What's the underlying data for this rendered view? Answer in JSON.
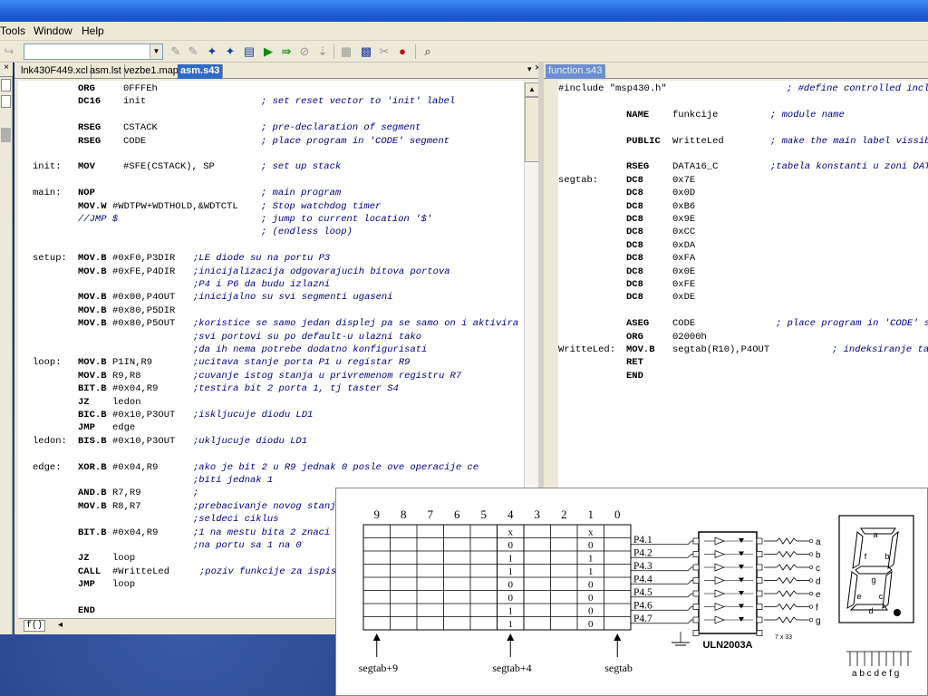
{
  "menu": {
    "items": [
      "Tools",
      "Window",
      "Help"
    ]
  },
  "toolbar": {
    "combo_value": ""
  },
  "left_editor": {
    "tabs": [
      "lnk430F449.xcl",
      "asm.lst",
      "vezbe1.map",
      "asm.s43"
    ],
    "active_tab": "asm.s43",
    "lines": [
      {
        "label": "",
        "op": "ORG",
        "arg": "0FFFEh",
        "comment": ""
      },
      {
        "label": "",
        "op": "DC16",
        "arg": "init",
        "comment": "; set reset vector to 'init' label"
      },
      {
        "label": "",
        "op": "",
        "arg": "",
        "comment": ""
      },
      {
        "label": "",
        "op": "RSEG",
        "arg": "CSTACK",
        "comment": "; pre-declaration of segment"
      },
      {
        "label": "",
        "op": "RSEG",
        "arg": "CODE",
        "comment": "; place program in 'CODE' segment"
      },
      {
        "label": "",
        "op": "",
        "arg": "",
        "comment": ""
      },
      {
        "label": "init:",
        "op": "MOV",
        "arg": "#SFE(CSTACK), SP",
        "comment": "; set up stack"
      },
      {
        "label": "",
        "op": "",
        "arg": "",
        "comment": ""
      },
      {
        "label": "main:",
        "op": "NOP",
        "arg": "",
        "comment": "; main program"
      },
      {
        "label": "",
        "op": "MOV.W",
        "arg": "#WDTPW+WDTHOLD,&WDTCTL",
        "comment": "; Stop watchdog timer"
      },
      {
        "label": "",
        "op": "",
        "arg": "",
        "comment": "//JMP $",
        "comment2": "; jump to current location '$'"
      },
      {
        "label": "",
        "op": "",
        "arg": "",
        "comment": "; (endless loop)"
      },
      {
        "label": "",
        "op": "",
        "arg": "",
        "comment": ""
      },
      {
        "label": "setup:",
        "op": "MOV.B",
        "arg": "#0xF0,P3DIR",
        "comment": ";LE diode su na portu P3"
      },
      {
        "label": "",
        "op": "MOV.B",
        "arg": "#0xFE,P4DIR",
        "comment": ";inicijalizacija odgovarajucih bitova portova"
      },
      {
        "label": "",
        "op": "",
        "arg": "",
        "comment": ";P4 i P6 da budu izlazni"
      },
      {
        "label": "",
        "op": "MOV.B",
        "arg": "#0x00,P4OUT",
        "comment": ";inicijalno su svi segmenti ugaseni"
      },
      {
        "label": "",
        "op": "MOV.B",
        "arg": "#0x80,P5DIR",
        "comment": ""
      },
      {
        "label": "",
        "op": "MOV.B",
        "arg": "#0x80,P5OUT",
        "comment": ";koristice se samo jedan displej pa se samo on i aktivira"
      },
      {
        "label": "",
        "op": "",
        "arg": "",
        "comment": ";svi portovi su po default-u ulazni tako"
      },
      {
        "label": "",
        "op": "",
        "arg": "",
        "comment": ";da ih nema potrebe dodatno konfigurisati"
      },
      {
        "label": "loop:",
        "op": "MOV.B",
        "arg": "P1IN,R9",
        "comment": ";ucitava stanje porta P1 u registar R9"
      },
      {
        "label": "",
        "op": "MOV.B",
        "arg": "R9,R8",
        "comment": ";cuvanje istog stanja u privremenom registru R7"
      },
      {
        "label": "",
        "op": "BIT.B",
        "arg": "#0x04,R9",
        "comment": ";testira bit 2 porta 1, tj taster S4"
      },
      {
        "label": "",
        "op": "JZ",
        "arg": "ledon",
        "comment": ""
      },
      {
        "label": "",
        "op": "BIC.B",
        "arg": "#0x10,P3OUT",
        "comment": ";iskljucuje diodu LD1"
      },
      {
        "label": "",
        "op": "JMP",
        "arg": "edge",
        "comment": ""
      },
      {
        "label": "ledon:",
        "op": "BIS.B",
        "arg": "#0x10,P3OUT",
        "comment": ";ukljucuje diodu LD1"
      },
      {
        "label": "",
        "op": "",
        "arg": "",
        "comment": ""
      },
      {
        "label": "edge:",
        "op": "XOR.B",
        "arg": "#0x04,R9",
        "comment": ";ako je bit 2 u R9 jednak 0 posle ove operacije ce"
      },
      {
        "label": "",
        "op": "",
        "arg": "",
        "comment": ";biti jednak 1"
      },
      {
        "label": "",
        "op": "AND.B",
        "arg": "R7,R9",
        "comment": ";"
      },
      {
        "label": "",
        "op": "MOV.B",
        "arg": "R8,R7",
        "comment": ";prebacivanje novog stanj"
      },
      {
        "label": "",
        "op": "",
        "arg": "",
        "comment": ";seldeci ciklus"
      },
      {
        "label": "",
        "op": "BIT.B",
        "arg": "#0x04,R9",
        "comment": ";1 na mestu bita 2 znaci"
      },
      {
        "label": "",
        "op": "",
        "arg": "",
        "comment": ";na portu sa 1 na 0"
      },
      {
        "label": "",
        "op": "JZ",
        "arg": "loop",
        "comment": ""
      },
      {
        "label": "",
        "op": "CALL",
        "arg": "#WritteLed",
        "comment": ";poziv funkcije za ispis"
      },
      {
        "label": "",
        "op": "JMP",
        "arg": "loop",
        "comment": ""
      },
      {
        "label": "",
        "op": "",
        "arg": "",
        "comment": ""
      },
      {
        "label": "",
        "op": "END",
        "arg": "",
        "comment": ""
      }
    ],
    "bottom_tab": "f()"
  },
  "right_editor": {
    "tabs": [
      "function.s43"
    ],
    "lines": [
      {
        "label": "",
        "op": "",
        "arg": "",
        "comment": "",
        "raw": "#include \"msp430.h\"",
        "comment_far": "; #define controlled incl"
      },
      {
        "label": "",
        "op": "",
        "arg": "",
        "comment": ""
      },
      {
        "label": "",
        "op": "NAME",
        "arg": "funkcije",
        "comment": "; module name"
      },
      {
        "label": "",
        "op": "",
        "arg": "",
        "comment": ""
      },
      {
        "label": "",
        "op": "PUBLIC",
        "arg": "WritteLed",
        "comment": "; make the main label vissib"
      },
      {
        "label": "",
        "op": "",
        "arg": "",
        "comment": ""
      },
      {
        "label": "",
        "op": "RSEG",
        "arg": "DATA16_C",
        "comment": ";tabela konstanti u zoni DAT"
      },
      {
        "label": "segtab:",
        "op": "DC8",
        "arg": "0x7E",
        "comment": ""
      },
      {
        "label": "",
        "op": "DC8",
        "arg": "0x0D",
        "comment": ""
      },
      {
        "label": "",
        "op": "DC8",
        "arg": "0xB6",
        "comment": ""
      },
      {
        "label": "",
        "op": "DC8",
        "arg": "0x9E",
        "comment": ""
      },
      {
        "label": "",
        "op": "DC8",
        "arg": "0xCC",
        "comment": ""
      },
      {
        "label": "",
        "op": "DC8",
        "arg": "0xDA",
        "comment": ""
      },
      {
        "label": "",
        "op": "DC8",
        "arg": "0xFA",
        "comment": ""
      },
      {
        "label": "",
        "op": "DC8",
        "arg": "0x0E",
        "comment": ""
      },
      {
        "label": "",
        "op": "DC8",
        "arg": "0xFE",
        "comment": ""
      },
      {
        "label": "",
        "op": "DC8",
        "arg": "0xDE",
        "comment": ""
      },
      {
        "label": "",
        "op": "",
        "arg": "",
        "comment": ""
      },
      {
        "label": "",
        "op": "ASEG",
        "arg": "CODE",
        "comment": "; place program in 'CODE' s"
      },
      {
        "label": "",
        "op": "ORG",
        "arg": "02000h",
        "comment": ""
      },
      {
        "label": "WritteLed:",
        "op": "MOV.B",
        "arg": "segtab(R10),P4OUT",
        "comment": "; indeksiranje ta"
      },
      {
        "label": "",
        "op": "RET",
        "arg": "",
        "comment": ""
      },
      {
        "label": "",
        "op": "END",
        "arg": "",
        "comment": ""
      }
    ]
  },
  "diagram": {
    "column_headers": [
      "9",
      "8",
      "7",
      "6",
      "5",
      "4",
      "3",
      "2",
      "1",
      "0"
    ],
    "col4_values": [
      "x",
      "0",
      "1",
      "1",
      "0",
      "0",
      "1",
      "1"
    ],
    "col0_values": [
      "x",
      "0",
      "1",
      "1",
      "0",
      "0",
      "0",
      "0"
    ],
    "port_labels": [
      "P4.1",
      "P4.2",
      "P4.3",
      "P4.4",
      "P4.5",
      "P4.6",
      "P4.7"
    ],
    "segment_labels": [
      "a",
      "b",
      "c",
      "d",
      "e",
      "f",
      "g"
    ],
    "pointer_labels": [
      "segtab+9",
      "segtab+4",
      "segtab"
    ],
    "chip_label": "ULN2003A",
    "resistor_note": "7 x 33",
    "display_segments": [
      "a",
      "f",
      "b",
      "g",
      "e",
      "c",
      "d"
    ],
    "display_pins": "a b c d e f g"
  }
}
